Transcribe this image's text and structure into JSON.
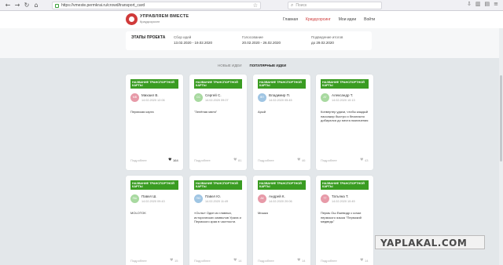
{
  "browser": {
    "url": "https://vmeste.permkrai.ru/crowd/transport_card",
    "search_placeholder": "Поиск"
  },
  "site": {
    "title": "УПРАВЛЯЕМ ВМЕСТЕ",
    "subtitle": "Краудсорсинг",
    "nav": [
      "Главная",
      "Краудсорсинг",
      "Мои идеи",
      "Войти"
    ]
  },
  "stages": {
    "title": "ЭТАПЫ ПРОЕКТА",
    "items": [
      {
        "label": "Сбор идей",
        "date": "13.02.2020 - 19.02.2020"
      },
      {
        "label": "Голосование",
        "date": "20.02.2020 - 26.02.2020"
      },
      {
        "label": "Подведение итогов",
        "date": "до 29.02.2020"
      }
    ]
  },
  "tabs": [
    "НОВЫЕ ИДЕИ",
    "ПОПУЛЯРНЫЕ ИДЕИ"
  ],
  "cards": [
    {
      "tag": "НАЗВАНИЕ ТРАНСПОРТНОЙ КАРТЫ",
      "initials": "МВ",
      "color": "#e79aa8",
      "author": "Михаил В.",
      "date": "14.02.2020 12:06",
      "text": "Пермская карта",
      "more": "Подробнее",
      "likes": "164"
    },
    {
      "tag": "НАЗВАНИЕ ТРАНСПОРТНОЙ КАРТЫ",
      "initials": "СС",
      "color": "#a8d9a0",
      "author": "Сергей С.",
      "date": "14.02.2020 09:07",
      "text": "\"Зелёная миля\"",
      "more": "Подробнее",
      "likes": "81"
    },
    {
      "tag": "НАЗВАНИЕ ТРАНСПОРТНОЙ КАРТЫ",
      "initials": "ВП",
      "color": "#9fc5e3",
      "author": "Владимир П.",
      "date": "14.02.2020 05:45",
      "text": "Арый",
      "more": "Подробнее",
      "likes": "46"
    },
    {
      "tag": "НАЗВАНИЕ ТРАНСПОРТНОЙ КАРТЫ",
      "initials": "АТ",
      "color": "#a8d9a0",
      "author": "Александр Т.",
      "date": "14.02.2020 10:13",
      "text": "Конвертер удачи, чтобы каждый пассажир быстро и безопасно добирался до места назначения",
      "more": "Подробнее",
      "likes": "43"
    },
    {
      "tag": "НАЗВАНИЕ ТРАНСПОРТНОЙ КАРТЫ",
      "initials": "ПШ",
      "color": "#a8d9a0",
      "author": "Павел Ш.",
      "date": "14.02.2020 09:43",
      "text": "MOLOTOK",
      "more": "Подробнее",
      "likes": "15"
    },
    {
      "tag": "НАЗВАНИЕ ТРАНСПОРТНОЙ КАРТЫ",
      "initials": "ПЮ",
      "color": "#9fc5e3",
      "author": "Павел Ю.",
      "date": "14.02.2020 11:49",
      "text": "«Ослы» Один из главных, исторических символов Урала и Пермского края в частности.",
      "more": "Подробнее",
      "likes": "14"
    },
    {
      "tag": "НАЗВАНИЕ ТРАНСПОРТНОЙ КАРТЫ",
      "initials": "АК",
      "color": "#e79aa8",
      "author": "Андрей К.",
      "date": "14.02.2020 20:06",
      "text": "Мишка",
      "more": "Подробнее",
      "likes": "14"
    },
    {
      "tag": "НАЗВАНИЕ ТРАНСПОРТНОЙ КАРТЫ",
      "initials": "ТТ",
      "color": "#e79aa8",
      "author": "Татьяна Т.",
      "date": "14.02.2020 10:45",
      "text": "Пермь Ош Ежевидр с кочки пермского языка \"Пермский медведь\"",
      "more": "Подробнее",
      "likes": "14"
    }
  ],
  "watermark": "YAPLAKAL.COM"
}
